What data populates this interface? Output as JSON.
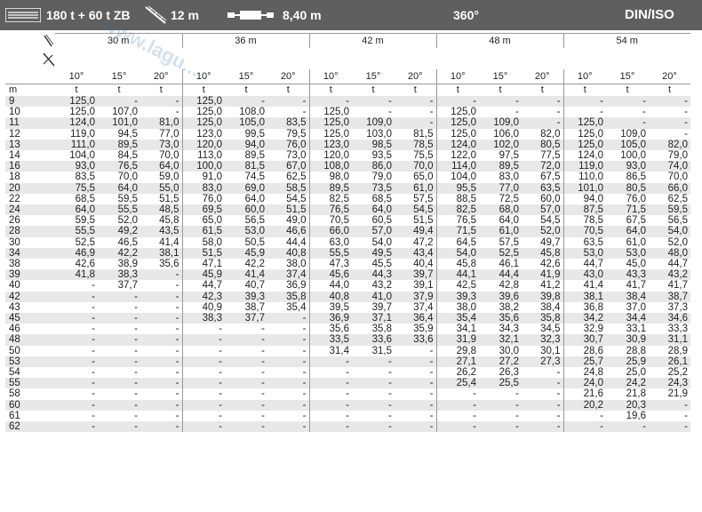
{
  "header": {
    "capacity": "180 t + 60 t ZB",
    "jib_length": "12 m",
    "counterweight_width": "8,40 m",
    "slew": "360°",
    "standard": "DIN/ISO"
  },
  "table": {
    "lengths": [
      "30 m",
      "36 m",
      "42 m",
      "48 m",
      "54 m"
    ],
    "angles": [
      "10°",
      "15°",
      "20°"
    ],
    "radius_unit": "m",
    "load_unit": "t",
    "rows": [
      [
        "9",
        "125,0",
        "-",
        "-",
        "125,0",
        "-",
        "-",
        "-",
        "-",
        "-",
        "-",
        "-",
        "-",
        "-",
        "-",
        "-"
      ],
      [
        "10",
        "125,0",
        "107,0",
        "-",
        "125,0",
        "108,0",
        "-",
        "125,0",
        "-",
        "-",
        "125,0",
        "-",
        "-",
        "-",
        "-",
        "-"
      ],
      [
        "11",
        "124,0",
        "101,0",
        "81,0",
        "125,0",
        "105,0",
        "83,5",
        "125,0",
        "109,0",
        "-",
        "125,0",
        "109,0",
        "-",
        "125,0",
        "-",
        "-"
      ],
      [
        "12",
        "119,0",
        "94,5",
        "77,0",
        "123,0",
        "99,5",
        "79,5",
        "125,0",
        "103,0",
        "81,5",
        "125,0",
        "106,0",
        "82,0",
        "125,0",
        "109,0",
        "-"
      ],
      [
        "13",
        "111,0",
        "89,5",
        "73,0",
        "120,0",
        "94,0",
        "76,0",
        "123,0",
        "98,5",
        "78,5",
        "124,0",
        "102,0",
        "80,5",
        "125,0",
        "105,0",
        "82,0"
      ],
      [
        "14",
        "104,0",
        "84,5",
        "70,0",
        "113,0",
        "89,5",
        "73,0",
        "120,0",
        "93,5",
        "75,5",
        "122,0",
        "97,5",
        "77,5",
        "124,0",
        "100,0",
        "79,0"
      ],
      [
        "16",
        "93,0",
        "76,5",
        "64,0",
        "100,0",
        "81,5",
        "67,0",
        "108,0",
        "86,0",
        "70,0",
        "114,0",
        "89,5",
        "72,0",
        "119,0",
        "93,0",
        "74,0"
      ],
      [
        "18",
        "83,5",
        "70,0",
        "59,0",
        "91,0",
        "74,5",
        "62,5",
        "98,0",
        "79,0",
        "65,0",
        "104,0",
        "83,0",
        "67,5",
        "110,0",
        "86,5",
        "70,0"
      ],
      [
        "20",
        "75,5",
        "64,0",
        "55,0",
        "83,0",
        "69,0",
        "58,5",
        "89,5",
        "73,5",
        "61,0",
        "95,5",
        "77,0",
        "63,5",
        "101,0",
        "80,5",
        "66,0"
      ],
      [
        "22",
        "68,5",
        "59,5",
        "51,5",
        "76,0",
        "64,0",
        "54,5",
        "82,5",
        "68,5",
        "57,5",
        "88,5",
        "72,5",
        "60,0",
        "94,0",
        "76,0",
        "62,5"
      ],
      [
        "24",
        "64,0",
        "55,5",
        "48,5",
        "69,5",
        "60,0",
        "51,5",
        "76,5",
        "64,0",
        "54,5",
        "82,5",
        "68,0",
        "57,0",
        "87,5",
        "71,5",
        "59,5"
      ],
      [
        "26",
        "59,5",
        "52,0",
        "45,8",
        "65,0",
        "56,5",
        "49,0",
        "70,5",
        "60,5",
        "51,5",
        "76,5",
        "64,0",
        "54,5",
        "78,5",
        "67,5",
        "56,5"
      ],
      [
        "28",
        "55,5",
        "49,2",
        "43,5",
        "61,5",
        "53,0",
        "46,6",
        "66,0",
        "57,0",
        "49,4",
        "71,5",
        "61,0",
        "52,0",
        "70,5",
        "64,0",
        "54,0"
      ],
      [
        "30",
        "52,5",
        "46,5",
        "41,4",
        "58,0",
        "50,5",
        "44,4",
        "63,0",
        "54,0",
        "47,2",
        "64,5",
        "57,5",
        "49,7",
        "63,5",
        "61,0",
        "52,0"
      ],
      [
        "34",
        "46,9",
        "42,2",
        "38,1",
        "51,5",
        "45,9",
        "40,8",
        "55,5",
        "49,5",
        "43,4",
        "54,0",
        "52,5",
        "45,8",
        "53,0",
        "53,0",
        "48,0"
      ],
      [
        "38",
        "42,6",
        "38,9",
        "35,6",
        "47,1",
        "42,2",
        "38,0",
        "47,3",
        "45,5",
        "40,4",
        "45,8",
        "46,1",
        "42,6",
        "44,7",
        "45,0",
        "44,7"
      ],
      [
        "39",
        "41,8",
        "38,3",
        "-",
        "45,9",
        "41,4",
        "37,4",
        "45,6",
        "44,3",
        "39,7",
        "44,1",
        "44,4",
        "41,9",
        "43,0",
        "43,3",
        "43,2"
      ],
      [
        "40",
        "-",
        "37,7",
        "-",
        "44,7",
        "40,7",
        "36,9",
        "44,0",
        "43,2",
        "39,1",
        "42,5",
        "42,8",
        "41,2",
        "41,4",
        "41,7",
        "41,7"
      ],
      [
        "42",
        "-",
        "-",
        "-",
        "42,3",
        "39,3",
        "35,8",
        "40,8",
        "41,0",
        "37,9",
        "39,3",
        "39,6",
        "39,8",
        "38,1",
        "38,4",
        "38,7"
      ],
      [
        "43",
        "-",
        "-",
        "-",
        "40,9",
        "38,7",
        "35,4",
        "39,5",
        "39,7",
        "37,4",
        "38,0",
        "38,2",
        "38,4",
        "36,8",
        "37,0",
        "37,3"
      ],
      [
        "45",
        "-",
        "-",
        "-",
        "38,3",
        "37,7",
        "-",
        "36,9",
        "37,1",
        "36,4",
        "35,4",
        "35,6",
        "35,8",
        "34,2",
        "34,4",
        "34,6"
      ],
      [
        "46",
        "-",
        "-",
        "-",
        "-",
        "-",
        "-",
        "35,6",
        "35,8",
        "35,9",
        "34,1",
        "34,3",
        "34,5",
        "32,9",
        "33,1",
        "33,3"
      ],
      [
        "48",
        "-",
        "-",
        "-",
        "-",
        "-",
        "-",
        "33,5",
        "33,6",
        "33,6",
        "31,9",
        "32,1",
        "32,3",
        "30,7",
        "30,9",
        "31,1"
      ],
      [
        "50",
        "-",
        "-",
        "-",
        "-",
        "-",
        "-",
        "31,4",
        "31,5",
        "-",
        "29,8",
        "30,0",
        "30,1",
        "28,6",
        "28,8",
        "28,9"
      ],
      [
        "53",
        "-",
        "-",
        "-",
        "-",
        "-",
        "-",
        "-",
        "-",
        "-",
        "27,1",
        "27,2",
        "27,3",
        "25,7",
        "25,9",
        "26,1"
      ],
      [
        "54",
        "-",
        "-",
        "-",
        "-",
        "-",
        "-",
        "-",
        "-",
        "-",
        "26,2",
        "26,3",
        "-",
        "24,8",
        "25,0",
        "25,2"
      ],
      [
        "55",
        "-",
        "-",
        "-",
        "-",
        "-",
        "-",
        "-",
        "-",
        "-",
        "25,4",
        "25,5",
        "-",
        "24,0",
        "24,2",
        "24,3"
      ],
      [
        "58",
        "-",
        "-",
        "-",
        "-",
        "-",
        "-",
        "-",
        "-",
        "-",
        "-",
        "-",
        "-",
        "21,6",
        "21,8",
        "21,9"
      ],
      [
        "60",
        "-",
        "-",
        "-",
        "-",
        "-",
        "-",
        "-",
        "-",
        "-",
        "-",
        "-",
        "-",
        "20,2",
        "20,3",
        "-"
      ],
      [
        "61",
        "-",
        "-",
        "-",
        "-",
        "-",
        "-",
        "-",
        "-",
        "-",
        "-",
        "-",
        "-",
        "-",
        "19,6",
        "-"
      ],
      [
        "62",
        "-",
        "-",
        "-",
        "-",
        "-",
        "-",
        "-",
        "-",
        "-",
        "-",
        "-",
        "-",
        "-",
        "-",
        "-"
      ]
    ]
  },
  "icons": {
    "capacity": "stacked-bars-icon",
    "jib": "lattice-jib-icon",
    "counterweight": "outrigger-base-icon",
    "hook": "hook-icon",
    "radius": "radius-arrow-icon",
    "angle": "offset-angle-icon"
  },
  "colors": {
    "header_bg": "#5f5f5f",
    "row_shade": "#e8e8e8",
    "watermark": "#3c78aa"
  }
}
